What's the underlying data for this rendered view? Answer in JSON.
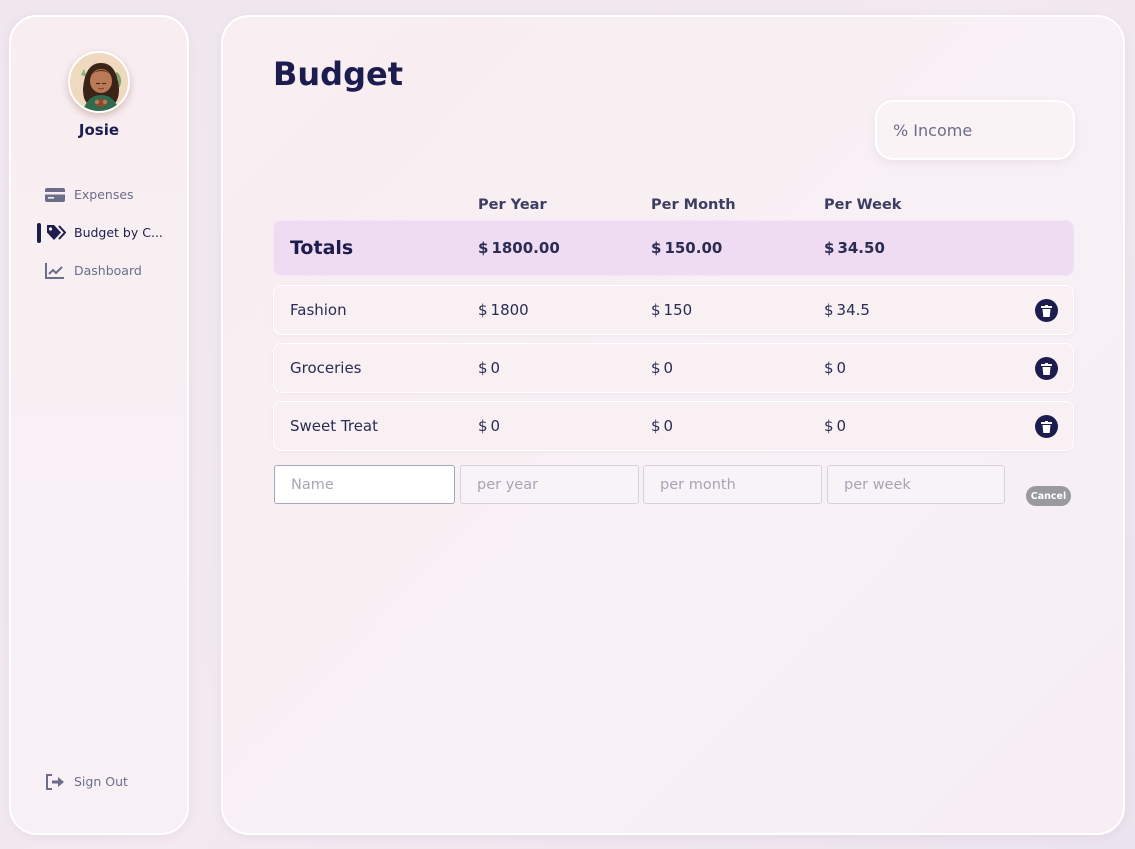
{
  "sidebar": {
    "user_name": "Josie",
    "nav": [
      {
        "label": "Expenses",
        "icon": "credit-card-icon",
        "active": false
      },
      {
        "label": "Budget by C...",
        "icon": "tags-icon",
        "active": true
      },
      {
        "label": "Dashboard",
        "icon": "line-chart-icon",
        "active": false
      }
    ],
    "sign_out": {
      "label": "Sign Out",
      "icon": "sign-out-icon"
    }
  },
  "main": {
    "title": "Budget",
    "income_placeholder": "% Income",
    "columns": [
      "Per Year",
      "Per Month",
      "Per Week"
    ],
    "totals": {
      "label": "Totals",
      "currency": "$",
      "per_year": "1800.00",
      "per_month": "150.00",
      "per_week": "34.50"
    },
    "rows": [
      {
        "name": "Fashion",
        "per_year": "1800",
        "per_month": "150",
        "per_week": "34.5"
      },
      {
        "name": "Groceries",
        "per_year": "0",
        "per_month": "0",
        "per_week": "0"
      },
      {
        "name": "Sweet Treat",
        "per_year": "0",
        "per_month": "0",
        "per_week": "0"
      }
    ],
    "new_row": {
      "name_placeholder": "Name",
      "per_year_placeholder": "per year",
      "per_month_placeholder": "per month",
      "per_week_placeholder": "per week",
      "cancel_label": "Cancel"
    }
  },
  "colors": {
    "primary": "#1c1d4e",
    "totals_bg": "#efdcf2",
    "muted_text": "#6c6d88",
    "cancel_bg": "#9a999c"
  }
}
